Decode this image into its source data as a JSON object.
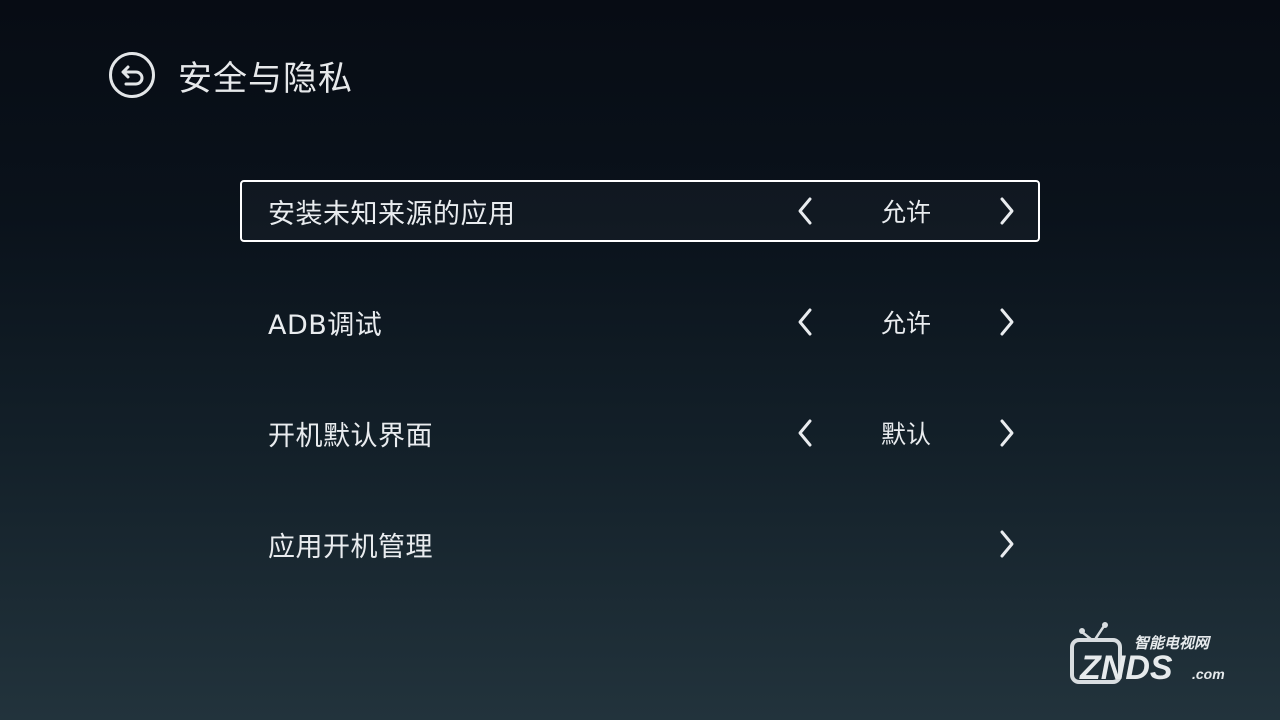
{
  "header": {
    "title": "安全与隐私",
    "back_icon": "back-arrow-icon"
  },
  "settings": [
    {
      "label": "安装未知来源的应用",
      "value": "允许",
      "has_options": true,
      "focused": true
    },
    {
      "label": "ADB调试",
      "value": "允许",
      "has_options": true,
      "focused": false
    },
    {
      "label": "开机默认界面",
      "value": "默认",
      "has_options": true,
      "focused": false
    },
    {
      "label": "应用开机管理",
      "value": "",
      "has_options": false,
      "focused": false
    }
  ],
  "watermark": {
    "top_text": "智能电视网",
    "brand": "ZNDS",
    "suffix": ".com"
  },
  "colors": {
    "text": "#e9ecef",
    "focus_border": "#ffffff",
    "background_top": "#070c14",
    "background_bottom": "#22333c"
  }
}
